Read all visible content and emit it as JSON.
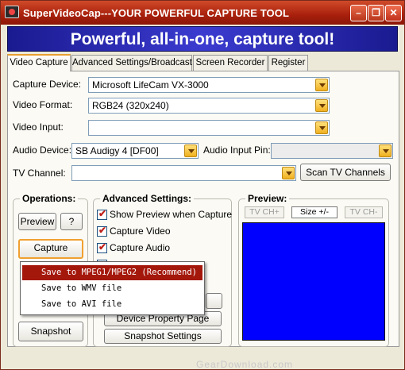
{
  "titlebar": {
    "title": "SuperVideoCap---YOUR POWERFUL CAPTURE TOOL",
    "minimize": "–",
    "restore": "❐",
    "close": "✕"
  },
  "banner": {
    "text": "Powerful, all-in-one, capture tool!"
  },
  "tabs": [
    {
      "label": "Video Capture",
      "active": true
    },
    {
      "label": "Advanced Settings/Broadcast"
    },
    {
      "label": "Screen Recorder"
    },
    {
      "label": "Register"
    }
  ],
  "form": {
    "capture_device_label": "Capture Device:",
    "capture_device_value": "Microsoft LifeCam VX-3000",
    "video_format_label": "Video Format:",
    "video_format_value": "RGB24 (320x240)",
    "video_input_label": "Video Input:",
    "video_input_value": "",
    "audio_device_label": "Audio Device:",
    "audio_device_value": "SB Audigy 4 [DF00]",
    "audio_input_pin_label": "Audio Input Pin:",
    "audio_input_pin_value": "",
    "tv_channel_label": "TV Channel:",
    "tv_channel_value": "",
    "scan_tv_channels": "Scan TV Channels"
  },
  "operations": {
    "title": "Operations:",
    "preview": "Preview",
    "help": "?",
    "capture": "Capture",
    "snapshot": "Snapshot"
  },
  "advanced": {
    "title": "Advanced Settings:",
    "show_preview": "Show Preview when Capture",
    "capture_video": "Capture Video",
    "capture_audio": "Capture Audio",
    "device_property": "Device Property Page",
    "snapshot_settings": "Snapshot Settings"
  },
  "preview": {
    "title": "Preview:",
    "tv_ch_plus": "TV CH+",
    "size": "Size +/-",
    "tv_ch_minus": "TV CH-"
  },
  "capture_menu": [
    {
      "label": "Save to MPEG1/MPEG2 (Recommend)",
      "selected": true
    },
    {
      "label": "Save to WMV file"
    },
    {
      "label": "Save to AVI file"
    }
  ],
  "watermark": "GearDownload.com",
  "colors": {
    "titlebar": "#a8200c",
    "banner": "#2a2ab0",
    "preview_bg": "#0000ff",
    "menu_selected": "#a4180c",
    "accent": "#f0a030"
  }
}
